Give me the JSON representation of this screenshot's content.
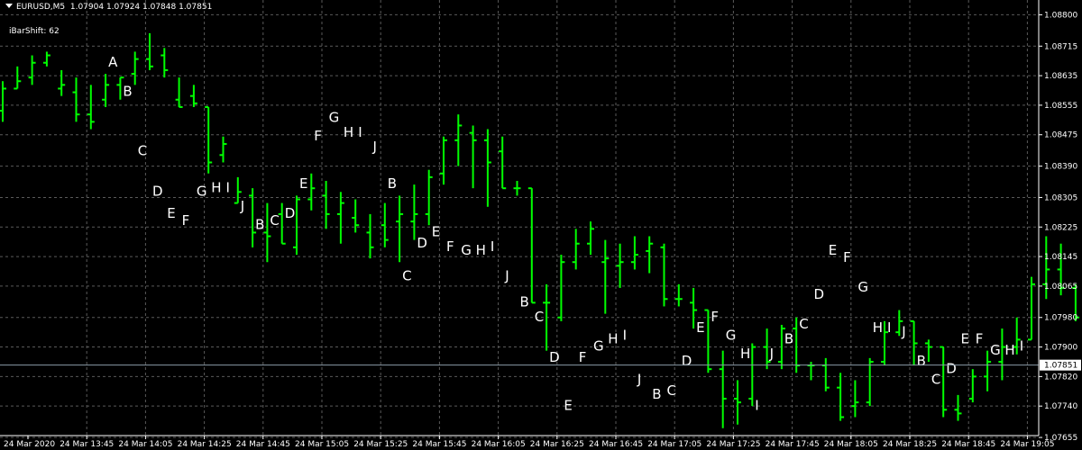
{
  "header": {
    "symbol": "EURUSD,M5",
    "ohlc": "1.07904 1.07924 1.07848 1.07851",
    "indicator": "iBarShift: 62"
  },
  "colors": {
    "background": "#000000",
    "bars": "#00ff00",
    "grid": "#5a5a5a",
    "text": "#ffffff",
    "current_price_line": "#8a9aa6"
  },
  "chart_data": {
    "type": "ohlc",
    "symbol": "EURUSD",
    "timeframe": "M5",
    "ylim": [
      1.0766,
      1.0884
    ],
    "grid": true,
    "y_ticks": [
      "1.08800",
      "1.08715",
      "1.08635",
      "1.08555",
      "1.08475",
      "1.08390",
      "1.08305",
      "1.08225",
      "1.08145",
      "1.08065",
      "1.07980",
      "1.07900",
      "1.07820",
      "1.07740",
      "1.07655"
    ],
    "current_price": "1.07851",
    "x_ticks": [
      "24 Mar 2020",
      "24 Mar 13:45",
      "24 Mar 14:05",
      "24 Mar 14:25",
      "24 Mar 14:45",
      "24 Mar 15:05",
      "24 Mar 15:25",
      "24 Mar 15:45",
      "24 Mar 16:05",
      "24 Mar 16:25",
      "24 Mar 16:45",
      "24 Mar 17:05",
      "24 Mar 17:25",
      "24 Mar 17:45",
      "24 Mar 18:05",
      "24 Mar 18:25",
      "24 Mar 18:45",
      "24 Mar 19:05"
    ],
    "bars": [
      {
        "o": 1.0854,
        "h": 1.0862,
        "l": 1.0851,
        "c": 1.086
      },
      {
        "o": 1.086,
        "h": 1.0866,
        "l": 1.086,
        "c": 1.0862
      },
      {
        "o": 1.0863,
        "h": 1.0869,
        "l": 1.0861,
        "c": 1.0867
      },
      {
        "o": 1.0867,
        "h": 1.087,
        "l": 1.0866,
        "c": 1.0869
      },
      {
        "o": 1.086,
        "h": 1.0865,
        "l": 1.0858,
        "c": 1.0861
      },
      {
        "o": 1.0859,
        "h": 1.0863,
        "l": 1.0851,
        "c": 1.0853
      },
      {
        "o": 1.0853,
        "h": 1.0861,
        "l": 1.0849,
        "c": 1.0851
      },
      {
        "o": 1.0857,
        "h": 1.0864,
        "l": 1.0855,
        "c": 1.0861
      },
      {
        "o": 1.0861,
        "h": 1.0863,
        "l": 1.0857,
        "c": 1.0863
      },
      {
        "o": 1.0864,
        "h": 1.087,
        "l": 1.0861,
        "c": 1.0868
      },
      {
        "o": 1.0868,
        "h": 1.0875,
        "l": 1.0865,
        "c": 1.0866
      },
      {
        "o": 1.0869,
        "h": 1.0871,
        "l": 1.0863,
        "c": 1.0865
      },
      {
        "o": 1.0857,
        "h": 1.0863,
        "l": 1.0855,
        "c": 1.0855
      },
      {
        "o": 1.0858,
        "h": 1.0861,
        "l": 1.0855,
        "c": 1.0856
      },
      {
        "o": 1.0855,
        "h": 1.0855,
        "l": 1.0837,
        "c": 1.084
      },
      {
        "o": 1.0842,
        "h": 1.0847,
        "l": 1.084,
        "c": 1.0845
      },
      {
        "o": 1.0829,
        "h": 1.0836,
        "l": 1.0829,
        "c": 1.0832
      },
      {
        "o": 1.0831,
        "h": 1.0833,
        "l": 1.0817,
        "c": 1.0821
      },
      {
        "o": 1.0821,
        "h": 1.0829,
        "l": 1.0813,
        "c": 1.082
      },
      {
        "o": 1.0826,
        "h": 1.0829,
        "l": 1.0818,
        "c": 1.0818
      },
      {
        "o": 1.0817,
        "h": 1.0831,
        "l": 1.0815,
        "c": 1.083
      },
      {
        "o": 1.083,
        "h": 1.0837,
        "l": 1.0827,
        "c": 1.0833
      },
      {
        "o": 1.0831,
        "h": 1.0835,
        "l": 1.0822,
        "c": 1.0826
      },
      {
        "o": 1.0826,
        "h": 1.0832,
        "l": 1.0818,
        "c": 1.0829
      },
      {
        "o": 1.0825,
        "h": 1.083,
        "l": 1.0821,
        "c": 1.0823
      },
      {
        "o": 1.0821,
        "h": 1.0826,
        "l": 1.0814,
        "c": 1.0817
      },
      {
        "o": 1.0823,
        "h": 1.0829,
        "l": 1.0817,
        "c": 1.0819
      },
      {
        "o": 1.0824,
        "h": 1.0831,
        "l": 1.0813,
        "c": 1.0826
      },
      {
        "o": 1.0824,
        "h": 1.0834,
        "l": 1.0819,
        "c": 1.0826
      },
      {
        "o": 1.0826,
        "h": 1.0838,
        "l": 1.0823,
        "c": 1.0836
      },
      {
        "o": 1.0837,
        "h": 1.0847,
        "l": 1.0834,
        "c": 1.0846
      },
      {
        "o": 1.0846,
        "h": 1.0853,
        "l": 1.0839,
        "c": 1.085
      },
      {
        "o": 1.0848,
        "h": 1.085,
        "l": 1.0833,
        "c": 1.0846
      },
      {
        "o": 1.0846,
        "h": 1.0849,
        "l": 1.0828,
        "c": 1.084
      },
      {
        "o": 1.0843,
        "h": 1.0847,
        "l": 1.0833,
        "c": 1.0833
      },
      {
        "o": 1.0833,
        "h": 1.0835,
        "l": 1.0831,
        "c": 1.0833
      },
      {
        "o": 1.0833,
        "h": 1.0833,
        "l": 1.0802,
        "c": 1.0802
      },
      {
        "o": 1.0802,
        "h": 1.0807,
        "l": 1.0789,
        "c": 1.0802
      },
      {
        "o": 1.0798,
        "h": 1.0815,
        "l": 1.0797,
        "c": 1.0813
      },
      {
        "o": 1.0813,
        "h": 1.0822,
        "l": 1.0811,
        "c": 1.0818
      },
      {
        "o": 1.0818,
        "h": 1.0824,
        "l": 1.0815,
        "c": 1.0822
      },
      {
        "o": 1.0813,
        "h": 1.0819,
        "l": 1.0799,
        "c": 1.0814
      },
      {
        "o": 1.0812,
        "h": 1.0818,
        "l": 1.0806,
        "c": 1.0813
      },
      {
        "o": 1.0813,
        "h": 1.082,
        "l": 1.0811,
        "c": 1.0815
      },
      {
        "o": 1.0816,
        "h": 1.082,
        "l": 1.081,
        "c": 1.0818
      },
      {
        "o": 1.0817,
        "h": 1.0818,
        "l": 1.0801,
        "c": 1.0803
      },
      {
        "o": 1.0803,
        "h": 1.0807,
        "l": 1.0801,
        "c": 1.0803
      },
      {
        "o": 1.0802,
        "h": 1.0806,
        "l": 1.0795,
        "c": 1.08
      },
      {
        "o": 1.08,
        "h": 1.08,
        "l": 1.0783,
        "c": 1.0784
      },
      {
        "o": 1.0784,
        "h": 1.0789,
        "l": 1.0768,
        "c": 1.0776
      },
      {
        "o": 1.0776,
        "h": 1.0781,
        "l": 1.0769,
        "c": 1.0775
      },
      {
        "o": 1.0776,
        "h": 1.0791,
        "l": 1.0774,
        "c": 1.079
      },
      {
        "o": 1.079,
        "h": 1.0795,
        "l": 1.0784,
        "c": 1.0786
      },
      {
        "o": 1.0786,
        "h": 1.0796,
        "l": 1.0784,
        "c": 1.0795
      },
      {
        "o": 1.0795,
        "h": 1.0798,
        "l": 1.0783,
        "c": 1.0785
      },
      {
        "o": 1.0785,
        "h": 1.0786,
        "l": 1.0781,
        "c": 1.0785
      },
      {
        "o": 1.0785,
        "h": 1.0787,
        "l": 1.0778,
        "c": 1.0779
      },
      {
        "o": 1.0779,
        "h": 1.0783,
        "l": 1.077,
        "c": 1.0771
      },
      {
        "o": 1.0774,
        "h": 1.0781,
        "l": 1.0771,
        "c": 1.0775
      },
      {
        "o": 1.0775,
        "h": 1.0787,
        "l": 1.0774,
        "c": 1.0786
      },
      {
        "o": 1.0786,
        "h": 1.0797,
        "l": 1.0785,
        "c": 1.0794
      },
      {
        "o": 1.0794,
        "h": 1.08,
        "l": 1.0793,
        "c": 1.0797
      },
      {
        "o": 1.0797,
        "h": 1.0797,
        "l": 1.0785,
        "c": 1.0791
      },
      {
        "o": 1.0791,
        "h": 1.0792,
        "l": 1.0786,
        "c": 1.079
      },
      {
        "o": 1.079,
        "h": 1.079,
        "l": 1.0771,
        "c": 1.0773
      },
      {
        "o": 1.0773,
        "h": 1.0777,
        "l": 1.077,
        "c": 1.0772
      },
      {
        "o": 1.0776,
        "h": 1.0784,
        "l": 1.0775,
        "c": 1.0782
      },
      {
        "o": 1.0782,
        "h": 1.0789,
        "l": 1.0778,
        "c": 1.0786
      },
      {
        "o": 1.0786,
        "h": 1.0795,
        "l": 1.0781,
        "c": 1.079
      },
      {
        "o": 1.079,
        "h": 1.0798,
        "l": 1.0788,
        "c": 1.0792
      },
      {
        "o": 1.0792,
        "h": 1.0809,
        "l": 1.0792,
        "c": 1.0807
      },
      {
        "o": 1.0807,
        "h": 1.082,
        "l": 1.0803,
        "c": 1.0811
      },
      {
        "o": 1.0811,
        "h": 1.0818,
        "l": 1.0804,
        "c": 1.0806
      },
      {
        "o": 1.0806,
        "h": 1.0807,
        "l": 1.0797,
        "c": 1.0798
      },
      {
        "o": 1.0798,
        "h": 1.08,
        "l": 1.0797,
        "c": 1.0797
      },
      {
        "o": 1.0797,
        "h": 1.0799,
        "l": 1.0785,
        "c": 1.0789
      },
      {
        "o": 1.079,
        "h": 1.0795,
        "l": 1.0785,
        "c": 1.0786
      },
      {
        "o": 1.0786,
        "h": 1.0789,
        "l": 1.0785,
        "c": 1.0786
      },
      {
        "o": 1.0786,
        "h": 1.0786,
        "l": 1.0779,
        "c": 1.0779
      },
      {
        "o": 1.0779,
        "h": 1.0782,
        "l": 1.0777,
        "c": 1.0781
      },
      {
        "o": 1.0781,
        "h": 1.0791,
        "l": 1.0779,
        "c": 1.079
      },
      {
        "o": 1.079,
        "h": 1.0794,
        "l": 1.0788,
        "c": 1.0789
      },
      {
        "o": 1.0789,
        "h": 1.0793,
        "l": 1.0783,
        "c": 1.0784
      },
      {
        "o": 1.0783,
        "h": 1.079,
        "l": 1.0775,
        "c": 1.0785
      },
      {
        "o": 1.0785,
        "h": 1.0792,
        "l": 1.078,
        "c": 1.0787
      },
      {
        "o": 1.0787,
        "h": 1.0793,
        "l": 1.0782,
        "c": 1.0785
      }
    ],
    "annotations": [
      {
        "text": "A",
        "bar": 7,
        "price": 1.0866
      },
      {
        "text": "B",
        "bar": 8,
        "price": 1.0858
      },
      {
        "text": "C",
        "bar": 9,
        "price": 1.0842
      },
      {
        "text": "D",
        "bar": 10,
        "price": 1.0831
      },
      {
        "text": "E",
        "bar": 11,
        "price": 1.0825
      },
      {
        "text": "F",
        "bar": 12,
        "price": 1.0823
      },
      {
        "text": "G",
        "bar": 13,
        "price": 1.0831
      },
      {
        "text": "H",
        "bar": 14,
        "price": 1.0832
      },
      {
        "text": "I",
        "bar": 15,
        "price": 1.0832
      },
      {
        "text": "J",
        "bar": 16,
        "price": 1.0827
      },
      {
        "text": "B",
        "bar": 17,
        "price": 1.0822
      },
      {
        "text": "C",
        "bar": 18,
        "price": 1.0823
      },
      {
        "text": "D",
        "bar": 19,
        "price": 1.0825
      },
      {
        "text": "E",
        "bar": 20,
        "price": 1.0833
      },
      {
        "text": "F",
        "bar": 21,
        "price": 1.0846
      },
      {
        "text": "G",
        "bar": 22,
        "price": 1.0851
      },
      {
        "text": "H",
        "bar": 23,
        "price": 1.0847
      },
      {
        "text": "I",
        "bar": 24,
        "price": 1.0847
      },
      {
        "text": "J",
        "bar": 25,
        "price": 1.0843
      },
      {
        "text": "B",
        "bar": 26,
        "price": 1.0833
      },
      {
        "text": "C",
        "bar": 27,
        "price": 1.0808
      },
      {
        "text": "D",
        "bar": 28,
        "price": 1.0817
      },
      {
        "text": "E",
        "bar": 29,
        "price": 1.082
      },
      {
        "text": "F",
        "bar": 30,
        "price": 1.0816
      },
      {
        "text": "G",
        "bar": 31,
        "price": 1.0815
      },
      {
        "text": "H",
        "bar": 32,
        "price": 1.0815
      },
      {
        "text": "I",
        "bar": 33,
        "price": 1.0816
      },
      {
        "text": "J",
        "bar": 34,
        "price": 1.0808
      },
      {
        "text": "B",
        "bar": 35,
        "price": 1.0801
      },
      {
        "text": "C",
        "bar": 36,
        "price": 1.0797
      },
      {
        "text": "D",
        "bar": 37,
        "price": 1.0786
      },
      {
        "text": "E",
        "bar": 38,
        "price": 1.0773
      },
      {
        "text": "F",
        "bar": 39,
        "price": 1.0786
      },
      {
        "text": "G",
        "bar": 40,
        "price": 1.0789
      },
      {
        "text": "H",
        "bar": 41,
        "price": 1.0791
      },
      {
        "text": "I",
        "bar": 42,
        "price": 1.0792
      },
      {
        "text": "J",
        "bar": 43,
        "price": 1.078
      },
      {
        "text": "B",
        "bar": 44,
        "price": 1.0776
      },
      {
        "text": "C",
        "bar": 45,
        "price": 1.0777
      },
      {
        "text": "D",
        "bar": 46,
        "price": 1.0785
      },
      {
        "text": "E",
        "bar": 47,
        "price": 1.0794
      },
      {
        "text": "F",
        "bar": 48,
        "price": 1.0797
      },
      {
        "text": "G",
        "bar": 49,
        "price": 1.0792
      },
      {
        "text": "H",
        "bar": 50,
        "price": 1.0787
      },
      {
        "text": "I",
        "bar": 51,
        "price": 1.0773
      },
      {
        "text": "J",
        "bar": 52,
        "price": 1.0787
      },
      {
        "text": "B",
        "bar": 53,
        "price": 1.0791
      },
      {
        "text": "C",
        "bar": 54,
        "price": 1.0795
      },
      {
        "text": "D",
        "bar": 55,
        "price": 1.0803
      },
      {
        "text": "E",
        "bar": 56,
        "price": 1.0815
      },
      {
        "text": "F",
        "bar": 57,
        "price": 1.0813
      },
      {
        "text": "G",
        "bar": 58,
        "price": 1.0805
      },
      {
        "text": "H",
        "bar": 59,
        "price": 1.0794
      },
      {
        "text": "I",
        "bar": 60,
        "price": 1.0794
      },
      {
        "text": "J",
        "bar": 61,
        "price": 1.0793
      },
      {
        "text": "B",
        "bar": 62,
        "price": 1.0785
      },
      {
        "text": "C",
        "bar": 63,
        "price": 1.078
      },
      {
        "text": "D",
        "bar": 64,
        "price": 1.0783
      },
      {
        "text": "E",
        "bar": 65,
        "price": 1.0791
      },
      {
        "text": "F",
        "bar": 66,
        "price": 1.0791
      },
      {
        "text": "G",
        "bar": 67,
        "price": 1.0788
      },
      {
        "text": "H",
        "bar": 68,
        "price": 1.0788
      },
      {
        "text": "I",
        "bar": 69,
        "price": 1.0789
      }
    ]
  }
}
